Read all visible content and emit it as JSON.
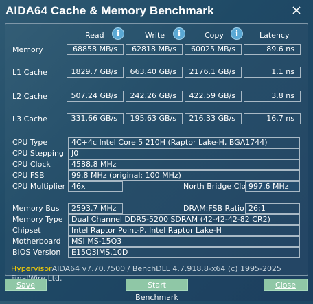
{
  "window": {
    "title": "AIDA64 Cache & Memory Benchmark",
    "close_glyph": "✕"
  },
  "bench": {
    "headers": {
      "read": "Read",
      "write": "Write",
      "copy": "Copy",
      "latency": "Latency"
    },
    "info_glyph": "i",
    "rows": [
      {
        "label": "Memory",
        "read": "68858 MB/s",
        "write": "62818 MB/s",
        "copy": "60025 MB/s",
        "latency": "89.6 ns"
      },
      {
        "label": "L1 Cache",
        "read": "1829.7 GB/s",
        "write": "663.40 GB/s",
        "copy": "2176.1 GB/s",
        "latency": "1.1 ns"
      },
      {
        "label": "L2 Cache",
        "read": "507.24 GB/s",
        "write": "242.26 GB/s",
        "copy": "422.59 GB/s",
        "latency": "3.8 ns"
      },
      {
        "label": "L3 Cache",
        "read": "331.66 GB/s",
        "write": "195.63 GB/s",
        "copy": "216.33 GB/s",
        "latency": "16.7 ns"
      }
    ]
  },
  "cpu": {
    "type_label": "CPU Type",
    "type_value": "4C+4c Intel Core 5 210H  (Raptor Lake-H, BGA1744)",
    "stepping_label": "CPU Stepping",
    "stepping_value": "J0",
    "clock_label": "CPU Clock",
    "clock_value": "4588.8 MHz",
    "fsb_label": "CPU FSB",
    "fsb_value": "99.8 MHz  (original: 100 MHz)",
    "multiplier_label": "CPU Multiplier",
    "multiplier_value": "46x",
    "nb_clock_label": "North Bridge Clock",
    "nb_clock_value": "997.6 MHz"
  },
  "memory": {
    "bus_label": "Memory Bus",
    "bus_value": "2593.7 MHz",
    "ratio_label": "DRAM:FSB Ratio",
    "ratio_value": "26:1",
    "type_label": "Memory Type",
    "type_value": "Dual Channel DDR5-5200 SDRAM  (42-42-42-82 CR2)",
    "chipset_label": "Chipset",
    "chipset_value": "Intel Raptor Point-P, Intel Raptor Lake-H",
    "motherboard_label": "Motherboard",
    "motherboard_value": "MSI MS-15Q3",
    "bios_label": "BIOS Version",
    "bios_value": "E15Q3IMS.10D"
  },
  "footer": {
    "hypervisor": "Hypervisor",
    "version_text": "AIDA64 v7.70.7500 / BenchDLL 4.7.918.8-x64  (c) 1995-2025 FinalWire Ltd."
  },
  "buttons": {
    "save": "Save",
    "start": "Start Benchmark",
    "close": "Close"
  },
  "colors": {
    "background": "#23486a",
    "button": "#8fc7a6",
    "hypervisor": "#ffd400",
    "info_icon": "#5aa8d4"
  }
}
